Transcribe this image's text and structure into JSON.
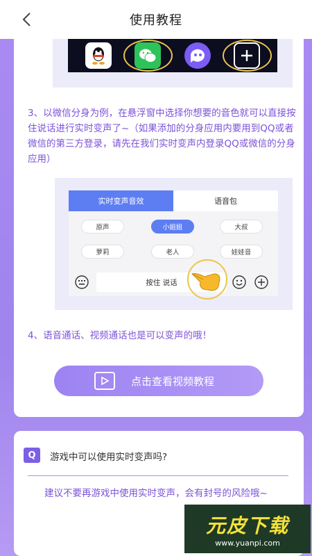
{
  "header": {
    "title": "使用教程",
    "back_icon": "chevron-left-icon"
  },
  "top_mockup": {
    "apps": [
      {
        "name": "qq-app-icon",
        "bg": "#ffffff"
      },
      {
        "name": "wechat-app-icon",
        "bg": "#2ec25a",
        "highlighted": true
      },
      {
        "name": "chat-app-icon",
        "bg": "#7b5cf5"
      },
      {
        "name": "add-app-icon",
        "bg": "#0d0d20",
        "highlighted": true
      }
    ]
  },
  "steps": {
    "step3": "3、以微信分身为例，在悬浮窗中选择你想要的音色就可以直接按住说话进行实时变声了~（如果添加的分身应用内要用到QQ或者微信的第三方登录，请先在我们实时变声内登录QQ或微信的分身应用）",
    "step4": "4、语音通话、视频通话也是可以变声的哦！"
  },
  "voice_mockup": {
    "tabs": [
      {
        "label": "实时变声音效",
        "active": true
      },
      {
        "label": "语音包",
        "active": false
      }
    ],
    "chips": [
      {
        "label": "原声",
        "selected": false
      },
      {
        "label": "小姐姐",
        "selected": true
      },
      {
        "label": "大叔",
        "selected": false
      },
      {
        "label": "萝莉",
        "selected": false
      },
      {
        "label": "老人",
        "selected": false
      },
      {
        "label": "娃娃音",
        "selected": false
      }
    ],
    "talk_button": "按住 说话"
  },
  "video_button": {
    "label": "点击查看视频教程"
  },
  "faq": {
    "badge": "Q",
    "question": "游戏中可以使用实时变声吗?",
    "answer": "建议不要再游戏中使用实时变声，会有封号的风险哦~"
  },
  "watermark": {
    "main": "元皮下载",
    "sub": "www.yuanpi.com"
  },
  "colors": {
    "accent": "#7c52d8",
    "tab_blue": "#5d7ef2",
    "bg_purple": "#a98af2"
  }
}
